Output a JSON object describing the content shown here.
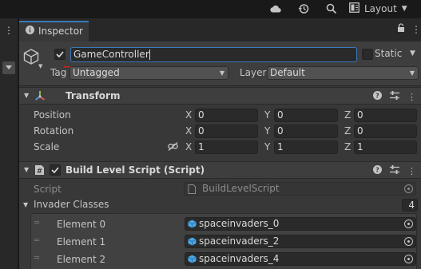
{
  "toolbar": {
    "layout_label": "Layout"
  },
  "inspector": {
    "tab_label": "Inspector"
  },
  "gameobject": {
    "name": "GameController",
    "active": true,
    "static_label": "Static",
    "tag_label": "Tag",
    "tag_value": "Untagged",
    "layer_label": "Layer",
    "layer_value": "Default"
  },
  "transform": {
    "title": "Transform",
    "rows": [
      {
        "label": "Position",
        "x": "0",
        "y": "0",
        "z": "0"
      },
      {
        "label": "Rotation",
        "x": "0",
        "y": "0",
        "z": "0"
      },
      {
        "label": "Scale",
        "x": "1",
        "y": "1",
        "z": "1"
      }
    ],
    "axis_x": "X",
    "axis_y": "Y",
    "axis_z": "Z"
  },
  "script_component": {
    "title": "Build Level Script (Script)",
    "enabled": true,
    "script_label": "Script",
    "script_value": "BuildLevelScript",
    "list_label": "Invader Classes",
    "list_count": "4",
    "elements": [
      {
        "label": "Element 0",
        "value": "spaceinvaders_0"
      },
      {
        "label": "Element 1",
        "value": "spaceinvaders_2"
      },
      {
        "label": "Element 2",
        "value": "spaceinvaders_4"
      }
    ]
  },
  "colors": {
    "accent": "#3a79bb",
    "annotation_underline": "#d21f1f",
    "panel_bg": "#383838"
  }
}
